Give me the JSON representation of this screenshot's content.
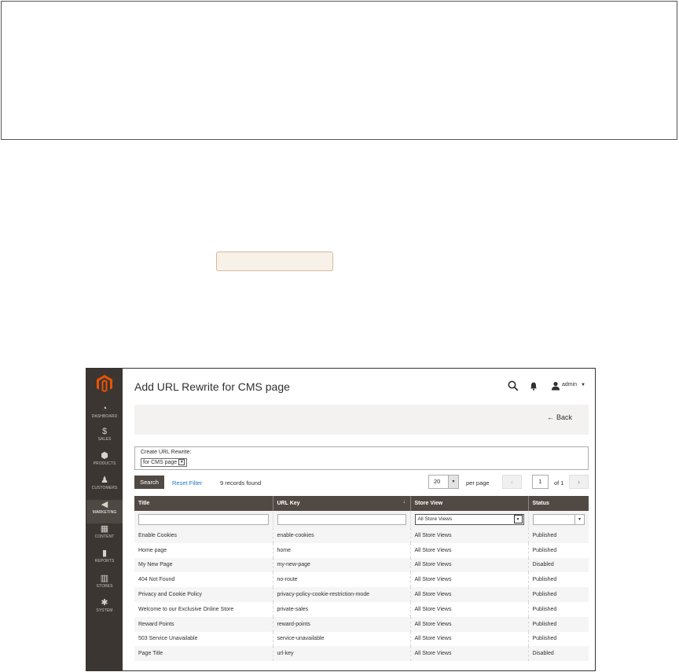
{
  "sidebar": {
    "items": [
      {
        "label": "DASHBOARD",
        "icon": "dashboard-icon",
        "glyph": "◔"
      },
      {
        "label": "SALES",
        "icon": "dollar-icon",
        "glyph": "$"
      },
      {
        "label": "PRODUCTS",
        "icon": "cube-icon",
        "glyph": "⬢"
      },
      {
        "label": "CUSTOMERS",
        "icon": "person-icon",
        "glyph": "♟"
      },
      {
        "label": "MARKETING",
        "icon": "megaphone-icon",
        "glyph": "◀"
      },
      {
        "label": "CONTENT",
        "icon": "content-icon",
        "glyph": "▦"
      },
      {
        "label": "REPORTS",
        "icon": "bar-chart-icon",
        "glyph": "▮"
      },
      {
        "label": "STORES",
        "icon": "store-icon",
        "glyph": "▥"
      },
      {
        "label": "SYSTEM",
        "icon": "gear-icon",
        "glyph": "✱"
      }
    ]
  },
  "header": {
    "title": "Add URL Rewrite for CMS page",
    "user": "admin"
  },
  "action_bar": {
    "back_label": "Back"
  },
  "form": {
    "create_label": "Create URL Rewrite:",
    "create_value": "for CMS page"
  },
  "toolbar": {
    "search_label": "Search",
    "reset_label": "Reset Filter",
    "records": "9 records found",
    "per_page_value": "20",
    "per_page_label": "per page",
    "current_page": "1",
    "of_pages": "of 1"
  },
  "grid": {
    "columns": [
      "Title",
      "URL Key",
      "Store View",
      "Status"
    ],
    "store_view_filter": "All Store Views",
    "rows": [
      [
        "Enable Cookies",
        "enable-cookies",
        "All Store Views",
        "Published"
      ],
      [
        "Home page",
        "home",
        "All Store Views",
        "Published"
      ],
      [
        "My New Page",
        "my-new-page",
        "All Store Views",
        "Disabled"
      ],
      [
        "404 Not Found",
        "no-route",
        "All Store Views",
        "Published"
      ],
      [
        "Privacy and Cookie Policy",
        "privacy-policy-cookie-restriction-mode",
        "All Store Views",
        "Published"
      ],
      [
        "Welcome to our Exclusive Online Store",
        "private-sales",
        "All Store Views",
        "Published"
      ],
      [
        "Reward Points",
        "reward-points",
        "All Store Views",
        "Published"
      ],
      [
        "503 Service Unavailable",
        "service-unavailable",
        "All Store Views",
        "Published"
      ],
      [
        "Page Title",
        "url-key",
        "All Store Views",
        "Disabled"
      ]
    ]
  },
  "colors": {
    "sidebar_bg": "#3b3632",
    "grid_header_bg": "#514943",
    "logo_orange": "#eb5202",
    "link_blue": "#1979c3"
  }
}
